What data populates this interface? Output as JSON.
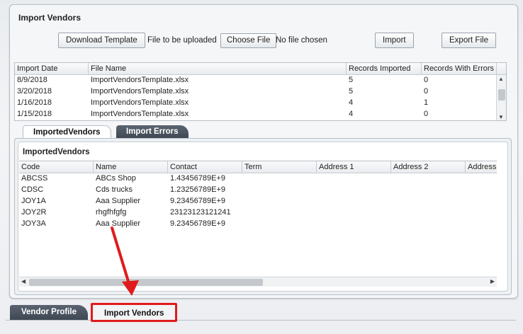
{
  "panel": {
    "title": "Import Vendors",
    "toolbar": {
      "download_template": "Download Template",
      "file_label": "File to be uploaded",
      "choose_file": "Choose File",
      "no_file": "No file chosen",
      "import": "Import",
      "export": "Export File"
    },
    "imports_table": {
      "columns": [
        "Import Date",
        "File Name",
        "Records Imported",
        "Records With Errors"
      ],
      "rows": [
        [
          "8/9/2018",
          "ImportVendorsTemplate.xlsx",
          "5",
          "0"
        ],
        [
          "3/20/2018",
          "ImportVendorsTemplate.xlsx",
          "5",
          "0"
        ],
        [
          "1/16/2018",
          "ImportVendorsTemplate.xlsx",
          "4",
          "1"
        ],
        [
          "1/15/2018",
          "ImportVendorsTemplate.xlsx",
          "4",
          "0"
        ]
      ]
    },
    "inner_tabs": [
      "ImportedVendors",
      "Import Errors"
    ],
    "imported_vendors": {
      "title": "ImportedVendors",
      "columns": [
        "Code",
        "Name",
        "Contact",
        "Term",
        "Address 1",
        "Address 2",
        "Address3"
      ],
      "rows": [
        [
          "ABCSS",
          "ABCs Shop",
          "1.43456789E+9"
        ],
        [
          "CDSC",
          "Cds trucks",
          "1.23256789E+9"
        ],
        [
          "JOY1A",
          "Aaa Supplier",
          "9.23456789E+9"
        ],
        [
          "JOY2R",
          "rhgfhfgfg",
          "23123123121241"
        ],
        [
          "JOY3A",
          "Aaa Supplier",
          "9.23456789E+9"
        ]
      ]
    }
  },
  "bottom_tabs": [
    "Vendor Profile",
    "Import Vendors"
  ],
  "colors": {
    "highlight": "#e01b1b",
    "tab_dark": "#3e4752"
  }
}
